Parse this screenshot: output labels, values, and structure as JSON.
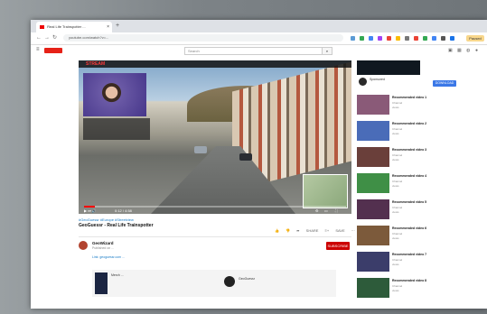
{
  "browser": {
    "tab_title": "Real Life Trainspotter ...",
    "tab_close": "×",
    "new_tab": "+",
    "url": "youtube.com/watch?v=...",
    "nav_back": "←",
    "nav_forward": "→",
    "nav_reload": "↻",
    "profile_label": "Paused"
  },
  "youtube": {
    "search_placeholder": "Search",
    "search_icon": "⌕",
    "menu_icon": "≡"
  },
  "player": {
    "stream_tag": "STREAM",
    "progress": 0.04,
    "time": "0:12 / 4:58",
    "controls": "▶ ⏭ 🔊"
  },
  "video": {
    "tags": "#GeoGuessr #Europe #Streetview",
    "title": "GeoGuessr - Real Life Trainspotter",
    "actions": "👍  👎  ➦ SHARE  ≡+ SAVE  ⋯",
    "channel": "GeoWizard",
    "date": "Published on ...",
    "subscribe": "SUBSCRIBE",
    "description": "Link: geoguessr.com ...",
    "merch_text": "Merch ...",
    "game_text": "GeoGuessr"
  },
  "sidebar": {
    "ad_text": "Sponsored",
    "ad_button": "DOWNLOAD",
    "recs": [
      {
        "title": "Recommended video 1",
        "meta": "Channel",
        "meta2": "views",
        "color": "#8a5a78"
      },
      {
        "title": "Recommended video 2",
        "meta": "Channel",
        "meta2": "views",
        "color": "#4a6cb8"
      },
      {
        "title": "Recommended video 3",
        "meta": "Channel",
        "meta2": "views",
        "color": "#6a3f3a"
      },
      {
        "title": "Recommended video 4",
        "meta": "Channel",
        "meta2": "views",
        "color": "#3f8f46"
      },
      {
        "title": "Recommended video 5",
        "meta": "Channel",
        "meta2": "views",
        "color": "#53304f"
      },
      {
        "title": "Recommended video 6",
        "meta": "Channel",
        "meta2": "views",
        "color": "#7c5a3b"
      },
      {
        "title": "Recommended video 7",
        "meta": "Channel",
        "meta2": "views",
        "color": "#3b3d6a"
      },
      {
        "title": "Recommended video 8",
        "meta": "Channel",
        "meta2": "views",
        "color": "#2d5b3a"
      }
    ]
  }
}
